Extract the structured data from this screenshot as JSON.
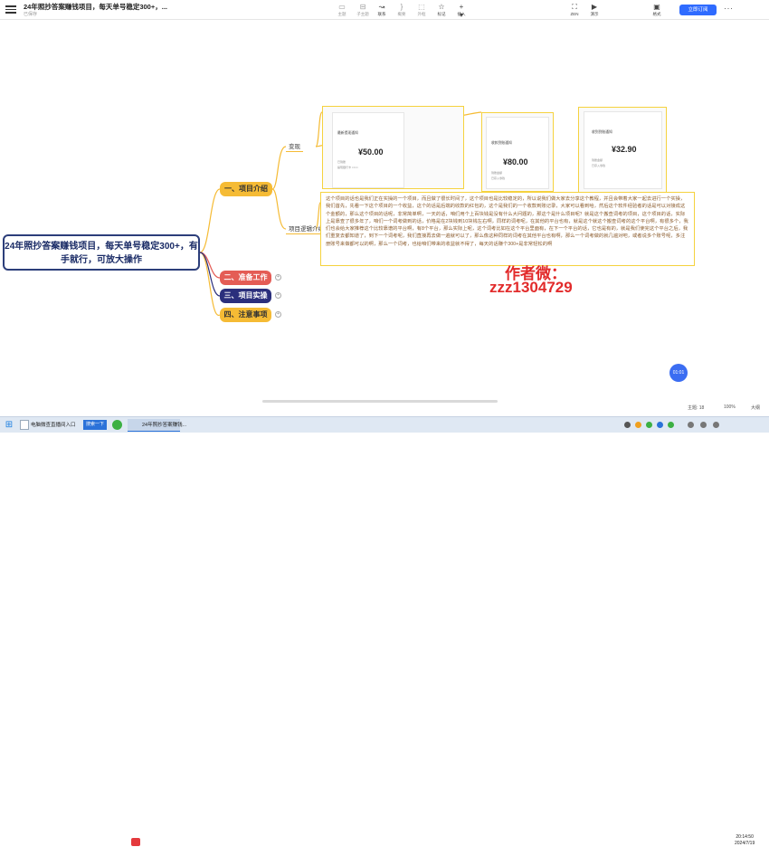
{
  "app": {
    "title": "24年照抄答案赚钱项目，每天单号稳定300+，...",
    "status": "已保存",
    "share_label": "立即订阅",
    "more_label": "···"
  },
  "toolbar": {
    "items": [
      {
        "label": "主题",
        "icon": "topic-icon"
      },
      {
        "label": "子主题",
        "icon": "subtopic-icon"
      },
      {
        "label": "联系",
        "icon": "link-icon"
      },
      {
        "label": "概要",
        "icon": "summary-icon"
      },
      {
        "label": "外框",
        "icon": "frame-icon"
      },
      {
        "label": "标记",
        "icon": "tag-icon"
      },
      {
        "label": "插入",
        "icon": "insert-icon"
      }
    ],
    "right": [
      {
        "label": "ZEN",
        "icon": "zen-icon"
      },
      {
        "label": "演示",
        "icon": "present-icon"
      },
      {
        "label": "格式",
        "icon": "format-icon"
      }
    ]
  },
  "mindmap": {
    "root": "24年照抄答案赚钱项目，每天单号稳定300+，有手就行，可放大操作",
    "branches": [
      "一、项目介绍",
      "二、准备工作",
      "三、项目实操",
      "四、注意事项"
    ],
    "sub_show": "变现",
    "sub_logic": "项目逻辑介绍",
    "shots": [
      {
        "title": "最新提现通知",
        "amount": "¥50.00",
        "line1": "已到账",
        "line2": "提现银行卡 ××××"
      },
      {
        "title": "收款到账通知",
        "amount": "¥80.00",
        "line1": "到账金额",
        "line2": "已存入零钱"
      },
      {
        "title": "收到到账通知",
        "amount": "¥32.90",
        "line1": "到账金额",
        "line2": "已存入零钱"
      }
    ],
    "paragraph": "这个项目的话也是我们正在实操的一个项目，而且做了很长时间了，这个项目也是比较稳定的，所以说我们做大家去分享这个教程，并且会带着大家一起去进行一个实操，我们首先，先看一下这个项目的一个收益，这个的话是后端的收款的红包的，这个是我们的一个收款到账记录，大家可以看到哈，然后这个软件经验者的话是可以对接成这个金额的，那么这个项目的话呢，非常简单啊，一天的话，咱们用个上百块钱是没有什么大问题的，那这个是什么项目呢？就是这个搬查词考的项目，这个项目的话，实际上是靠查了很多年了，咱们一个词考做到的话，价格是在2块钱到10块钱左右啊，同样的词考呢，在其他的平台也有，就是这个就这个搬查词考的这个平台啊，有很多个，我们也会给大家推荐这个比较靠谱的平台啊，有8个平台，那么实际上呢，这个词考比如在这个平台里面有，在下一个平台的话，它也是有的，就是我们使完这个平台之后，我们重复去都知道了，到下一个词考呢，我们直接再去做一遍就可以了，那么像这种同样的词考在其他平台也有啊，那么一个词考做的就几遍对吧，或者说多个账号呢，多注册账号来做都可以的啊，那么一个词考，也给咱们带来的收益就不得了，每天的话赚个300+是非常轻松的啊",
    "watermark_line1": "作者微：",
    "watermark_line2": "zzz1304729",
    "time_bubble": "01:01"
  },
  "statusbar": {
    "words": "主题: 18",
    "zoom": "100%",
    "fit": "大纲"
  },
  "taskbar": {
    "item1": "电脑微查直播间入口",
    "search_btn": "搜索一下",
    "active": "24年照抄答案赚钱...",
    "time": "20:14:50",
    "date": "2024/7/19"
  }
}
